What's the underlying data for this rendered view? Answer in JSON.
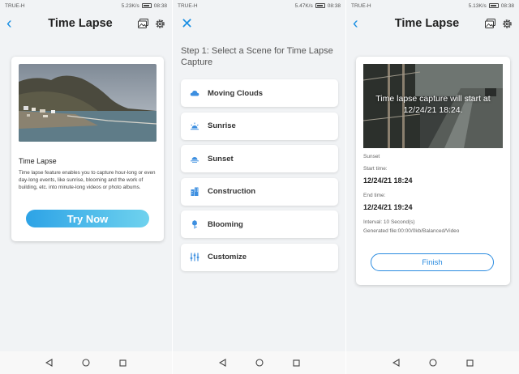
{
  "screens": [
    {
      "status": {
        "carrier": "TRUE-H",
        "speed": "5.23K/s",
        "time": "08:38"
      },
      "title": "Time Lapse",
      "card": {
        "heading": "Time Lapse",
        "description": "Time lapse feature enables you to capture hour-long or even day-long events, like sunrise, blooming and the work of building, etc. into minute-long videos or photo albums.",
        "button": "Try Now"
      }
    },
    {
      "status": {
        "carrier": "TRUE-H",
        "speed": "5.47K/s",
        "time": "08:38"
      },
      "close_glyph": "✕",
      "step": "Step 1: Select a Scene for Time Lapse Capture",
      "scenes": [
        {
          "label": "Moving Clouds",
          "icon": "cloud-icon"
        },
        {
          "label": "Sunrise",
          "icon": "sunrise-icon"
        },
        {
          "label": "Sunset",
          "icon": "sunset-icon"
        },
        {
          "label": "Construction",
          "icon": "building-icon"
        },
        {
          "label": "Blooming",
          "icon": "flower-icon"
        },
        {
          "label": "Customize",
          "icon": "sliders-icon"
        }
      ]
    },
    {
      "status": {
        "carrier": "TRUE-H",
        "speed": "5.13K/s",
        "time": "08:38"
      },
      "title": "Time Lapse",
      "overlay": "Time lapse capture will start at 12/24/21 18:24.",
      "scene": "Sunset",
      "start_label": "Start time:",
      "start_value": "12/24/21 18:24",
      "end_label": "End time:",
      "end_value": "12/24/21 19:24",
      "interval": "Interval: 10 Second(s)",
      "generated": "Generated file:00:00/0kb/Balanced/Video",
      "button": "Finish"
    }
  ],
  "colors": {
    "accent": "#1a8fe3",
    "button_gradient_start": "#2da3e6",
    "button_gradient_end": "#6fd2ee",
    "background": "#f1f3f5"
  }
}
